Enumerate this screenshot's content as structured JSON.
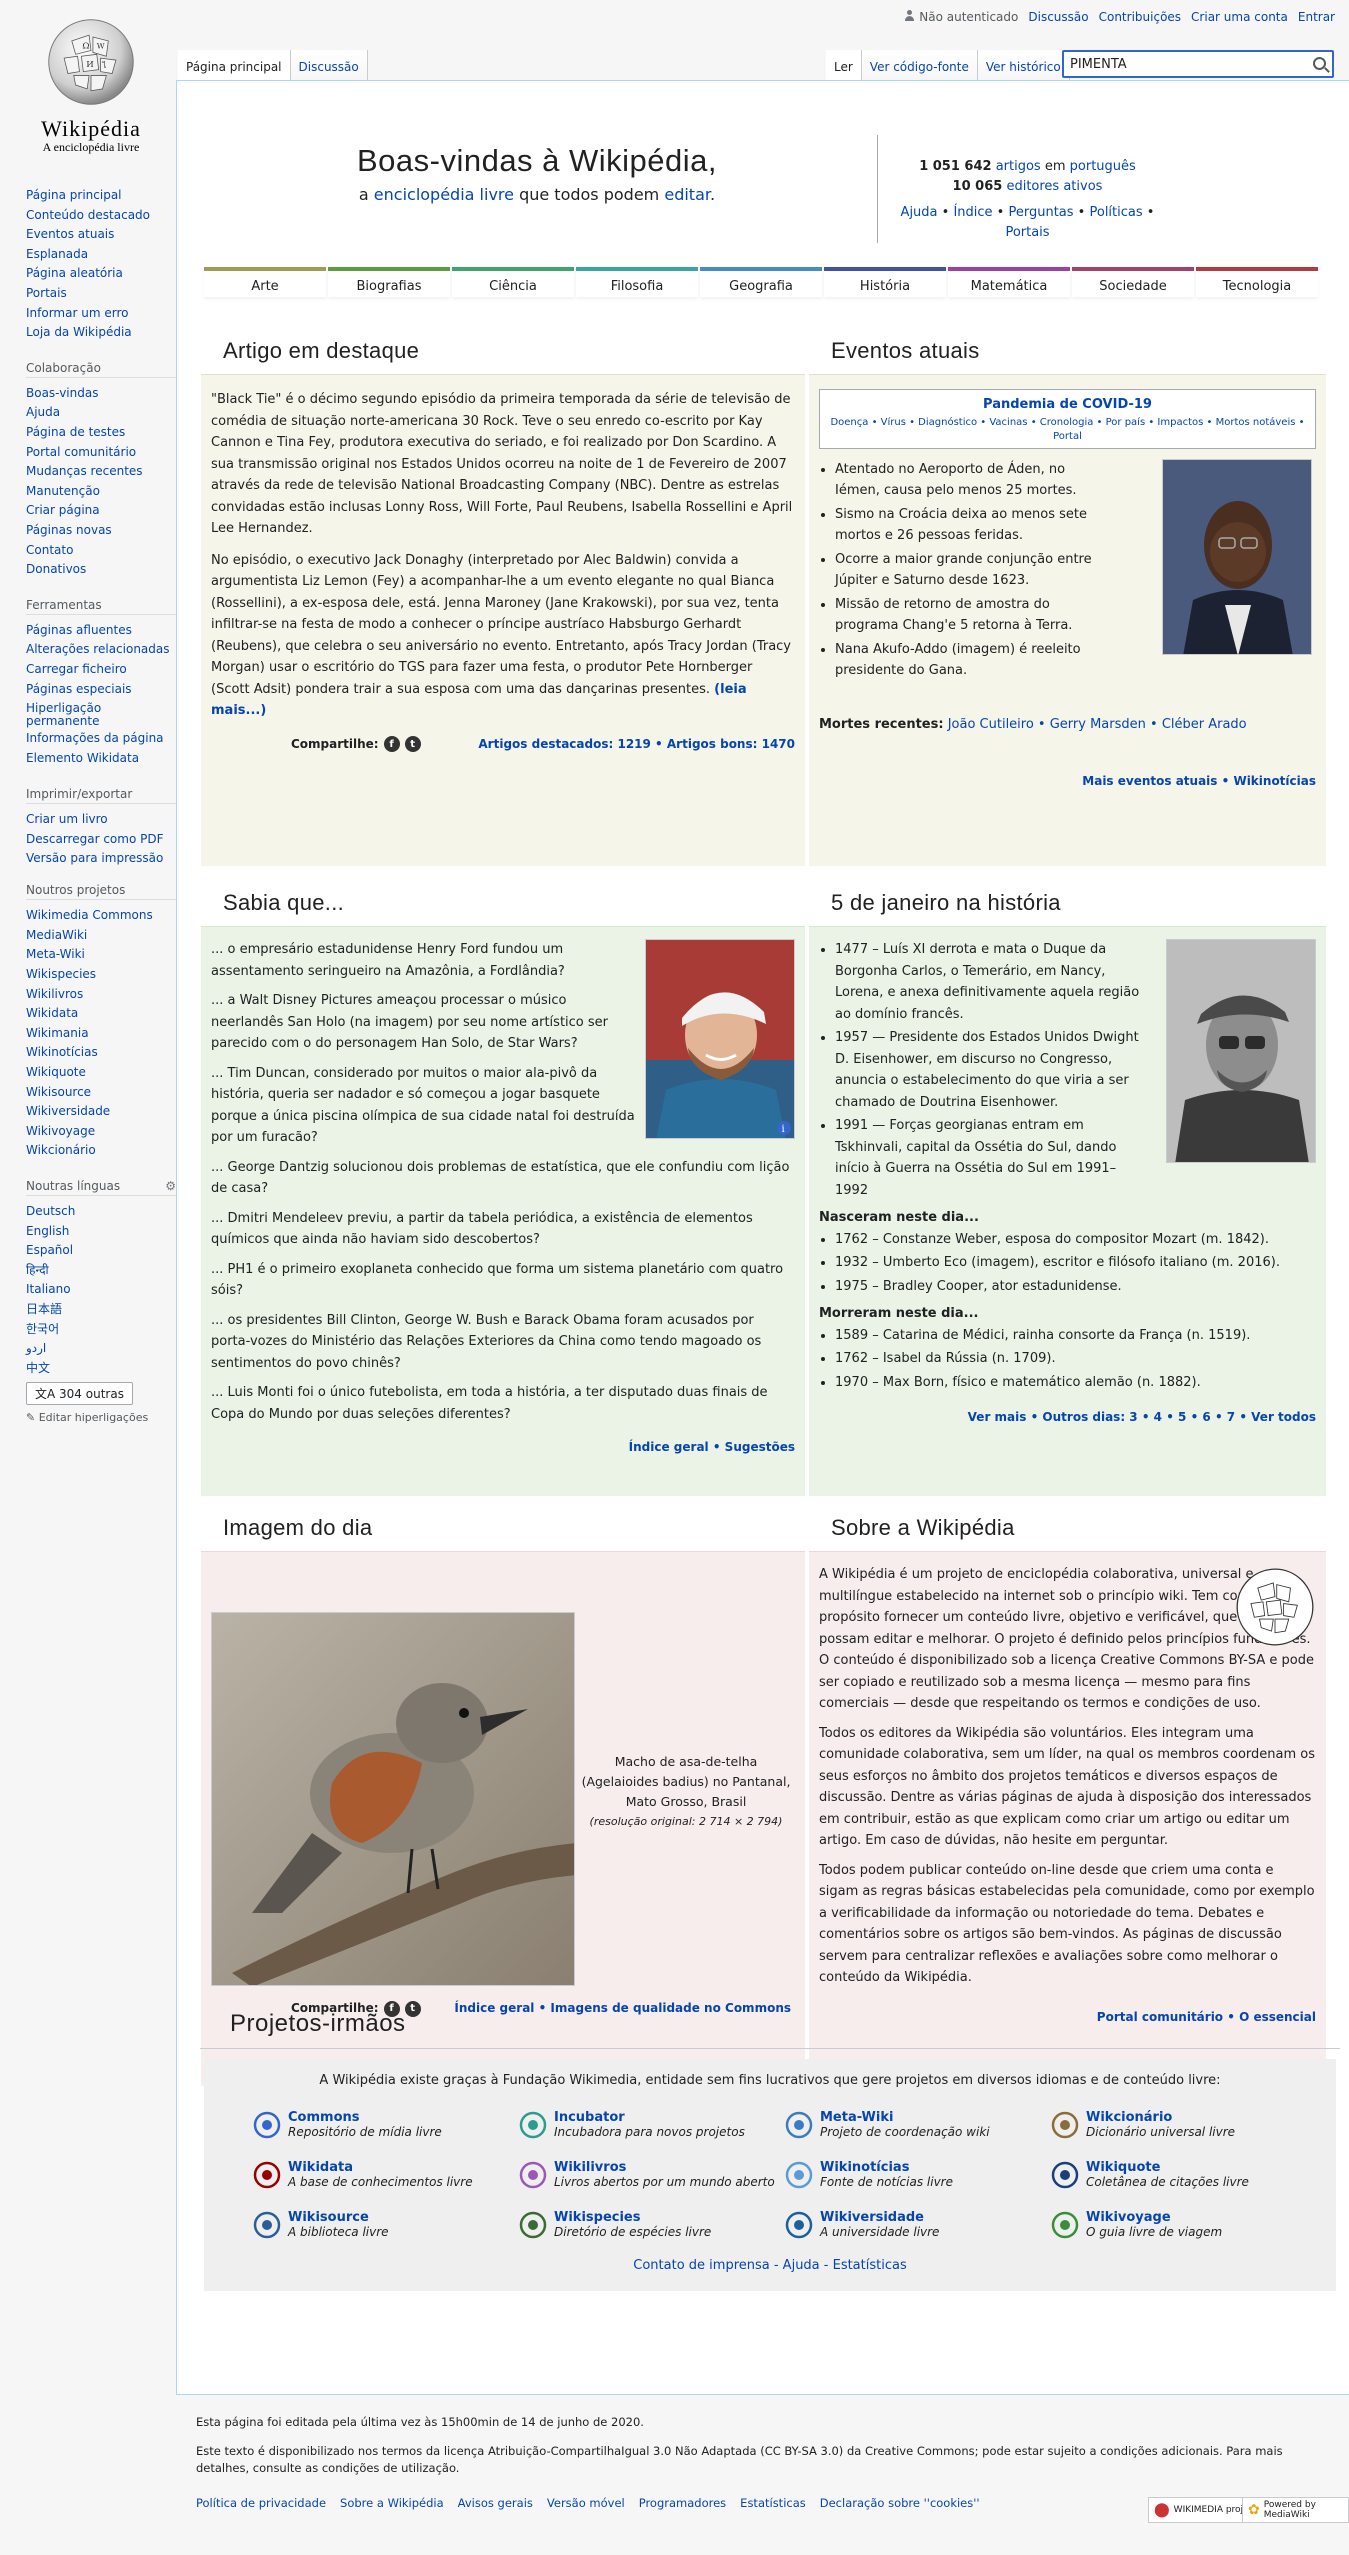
{
  "personal": {
    "not_logged": "Não autenticado",
    "talk": "Discussão",
    "contribs": "Contribuições",
    "create": "Criar uma conta",
    "login": "Entrar"
  },
  "logo": {
    "wordmark": "Wikipédia",
    "tagline": "A enciclopédia livre"
  },
  "tabs": {
    "main_page": "Página principal",
    "discussion": "Discussão",
    "read": "Ler",
    "view_source": "Ver código-fonte",
    "history": "Ver histórico"
  },
  "search": {
    "value": "PIMENTA"
  },
  "sidebar": {
    "nav": [
      "Página principal",
      "Conteúdo destacado",
      "Eventos atuais",
      "Esplanada",
      "Página aleatória",
      "Portais",
      "Informar um erro",
      "Loja da Wikipédia"
    ],
    "collab_title": "Colaboração",
    "collab": [
      "Boas-vindas",
      "Ajuda",
      "Página de testes",
      "Portal comunitário",
      "Mudanças recentes",
      "Manutenção",
      "Criar página",
      "Páginas novas",
      "Contato",
      "Donativos"
    ],
    "tools_title": "Ferramentas",
    "tools": [
      "Páginas afluentes",
      "Alterações relacionadas",
      "Carregar ficheiro",
      "Páginas especiais",
      "Hiperligação permanente",
      "Informações da página",
      "Elemento Wikidata"
    ],
    "print_title": "Imprimir/exportar",
    "print": [
      "Criar um livro",
      "Descarregar como PDF",
      "Versão para impressão"
    ],
    "projects_title": "Noutros projetos",
    "projects": [
      "Wikimedia Commons",
      "MediaWiki",
      "Meta-Wiki",
      "Wikispecies",
      "Wikilivros",
      "Wikidata",
      "Wikimania",
      "Wikinotícias",
      "Wikiquote",
      "Wikisource",
      "Wikiversidade",
      "Wikivoyage",
      "Wikcionário"
    ],
    "langs_title": "Noutras línguas",
    "langs": [
      "Deutsch",
      "English",
      "Español",
      "हिन्दी",
      "Italiano",
      "日本語",
      "한국어",
      "اردو",
      "中文"
    ],
    "more_langs": "304 outras",
    "edit_links": "Editar hiperligações"
  },
  "welcome": {
    "title": "Boas-vindas à Wikipédia,",
    "sub_a": "a ",
    "sub_link1": "enciclopédia livre",
    "sub_b": " que todos podem ",
    "sub_link2": "editar",
    "sub_c": "."
  },
  "stats": {
    "articles_count": "1 051 642",
    "articles_word": "artigos",
    "in": " em ",
    "language": "português",
    "editors_count": "10 065",
    "editors_word": "editores ativos",
    "links": [
      "Ajuda",
      "Índice",
      "Perguntas",
      "Políticas",
      "Portais"
    ]
  },
  "portals": [
    {
      "name": "Arte",
      "color": "#9d9d53"
    },
    {
      "name": "Biografias",
      "color": "#5d9b41"
    },
    {
      "name": "Ciência",
      "color": "#41a46d"
    },
    {
      "name": "Filosofia",
      "color": "#3aa3a3"
    },
    {
      "name": "Geografia",
      "color": "#468bc2"
    },
    {
      "name": "História",
      "color": "#4152a3"
    },
    {
      "name": "Matemática",
      "color": "#9a41a3"
    },
    {
      "name": "Sociedade",
      "color": "#a3416a"
    },
    {
      "name": "Tecnologia",
      "color": "#b03d3d"
    }
  ],
  "featured": {
    "title": "Artigo em destaque",
    "p1": "\"Black Tie\" é o décimo segundo episódio da primeira temporada da série de televisão de comédia de situação norte-americana 30 Rock. Teve o seu enredo co-escrito por Kay Cannon e Tina Fey, produtora executiva do seriado, e foi realizado por Don Scardino. A sua transmissão original nos Estados Unidos ocorreu na noite de 1 de Fevereiro de 2007 através da rede de televisão National Broadcasting Company (NBC). Dentre as estrelas convidadas estão inclusas Lonny Ross, Will Forte, Paul Reubens, Isabella Rossellini e April Lee Hernandez.",
    "p2": "No episódio, o executivo Jack Donaghy (interpretado por Alec Baldwin) convida a argumentista Liz Lemon (Fey) a acompanhar-lhe a um evento elegante no qual Bianca (Rossellini), a ex-esposa dele, está. Jenna Maroney (Jane Krakowski), por sua vez, tenta infiltrar-se na festa de modo a conhecer o príncipe austríaco Habsburgo Gerhardt (Reubens), que celebra o seu aniversário no evento. Entretanto, após Tracy Jordan (Tracy Morgan) usar o escritório do TGS para fazer uma festa, o produtor Pete Hornberger (Scott Adsit) pondera trair a sua esposa com uma das dançarinas presentes.",
    "more": "(leia mais...)",
    "share": "Compartilhe:",
    "footer": "Artigos destacados: 1219 • Artigos bons: 1470"
  },
  "events": {
    "title": "Eventos atuais",
    "covid_title": "Pandemia de COVID-19",
    "covid_links": "Doença • Vírus • Diagnóstico • Vacinas • Cronologia • Por país • Impactos • Mortos notáveis • Portal",
    "items": [
      "Atentado no Aeroporto de Áden, no Iémen, causa pelo menos 25 mortes.",
      "Sismo na Croácia deixa ao menos sete mortos e 26 pessoas feridas.",
      "Ocorre a maior grande conjunção entre Júpiter e Saturno desde 1623.",
      "Missão de retorno de amostra do programa Chang'e 5 retorna à Terra.",
      "Nana Akufo-Addo (imagem) é reeleito presidente do Gana."
    ],
    "deaths_label": "Mortes recentes:",
    "deaths": "João Cutileiro • Gerry Marsden • Cléber Arado",
    "footer": "Mais eventos atuais • Wikinotícias"
  },
  "didyouknow": {
    "title": "Sabia que...",
    "items": [
      "... o empresário estadunidense Henry Ford fundou um assentamento seringueiro na Amazônia, a Fordlândia?",
      "... a Walt Disney Pictures ameaçou processar o músico neerlandês San Holo (na imagem) por seu nome artístico ser parecido com o do personagem Han Solo, de Star Wars?",
      "... Tim Duncan, considerado por muitos o maior ala-pivô da história, queria ser nadador e só começou a jogar basquete porque a única piscina olímpica de sua cidade natal foi destruída por um furacão?",
      "... George Dantzig solucionou dois problemas de estatística, que ele confundiu com lição de casa?",
      "... Dmitri Mendeleev previu, a partir da tabela periódica, a existência de elementos químicos que ainda não haviam sido descobertos?",
      "... PH1 é o primeiro exoplaneta conhecido que forma um sistema planetário com quatro sóis?",
      "... os presidentes Bill Clinton, George W. Bush e Barack Obama foram acusados por porta-vozes do Ministério das Relações Exteriores da China como tendo magoado os sentimentos do povo chinês?",
      "... Luis Monti foi o único futebolista, em toda a história, a ter disputado duas finais de Copa do Mundo por duas seleções diferentes?"
    ],
    "footer": "Índice geral • Sugestões"
  },
  "onthisday": {
    "title": "5 de janeiro na história",
    "items": [
      "1477 – Luís XI derrota e mata o Duque da Borgonha Carlos, o Temerário, em Nancy, Lorena, e anexa definitivamente aquela região ao domínio francês.",
      "1957 — Presidente dos Estados Unidos Dwight D. Eisenhower, em discurso no Congresso, anuncia o estabelecimento do que viria a ser chamado de Doutrina Eisenhower.",
      "1991 — Forças georgianas entram em Tskhinvali, capital da Ossétia do Sul, dando início à Guerra na Ossétia do Sul em 1991–1992"
    ],
    "born_label": "Nasceram neste dia...",
    "born": [
      "1762 – Constanze Weber, esposa do compositor Mozart (m. 1842).",
      "1932 – Umberto Eco (imagem), escritor e filósofo italiano (m. 2016).",
      "1975 – Bradley Cooper, ator estadunidense."
    ],
    "died_label": "Morreram neste dia...",
    "died": [
      "1589 – Catarina de Médici, rainha consorte da França (n. 1519).",
      "1762 – Isabel da Rússia (n. 1709).",
      "1970 – Max Born, físico e matemático alemão (n. 1882)."
    ],
    "footer": "Ver mais • Outros dias: 3 • 4 • 5 • 6 • 7 • Ver todos"
  },
  "pictureofday": {
    "title": "Imagem do dia",
    "caption_1": "Macho de asa-de-telha",
    "caption_2": "(Agelaioides badius) no Pantanal,",
    "caption_3": "Mato Grosso, Brasil",
    "caption_4": "(resolução original: 2 714 × 2 794)",
    "share": "Compartilhe:",
    "footer": "Índice geral • Imagens de qualidade no Commons"
  },
  "about": {
    "title": "Sobre a Wikipédia",
    "p1": "A Wikipédia é um projeto de enciclopédia colaborativa, universal e multilíngue estabelecido na internet sob o princípio wiki. Tem como propósito fornecer um conteúdo livre, objetivo e verificável, que todos possam editar e melhorar. O projeto é definido pelos princípios fundadores. O conteúdo é disponibilizado sob a licença Creative Commons BY-SA e pode ser copiado e reutilizado sob a mesma licença — mesmo para fins comerciais — desde que respeitando os termos e condições de uso.",
    "p2": "Todos os editores da Wikipédia são voluntários. Eles integram uma comunidade colaborativa, sem um líder, na qual os membros coordenam os seus esforços no âmbito dos projetos temáticos e diversos espaços de discussão. Dentre as várias páginas de ajuda à disposição dos interessados em contribuir, estão as que explicam como criar um artigo ou editar um artigo. Em caso de dúvidas, não hesite em perguntar.",
    "p3": "Todos podem publicar conteúdo on-line desde que criem uma conta e sigam as regras básicas estabelecidas pela comunidade, como por exemplo a verificabilidade da informação ou notoriedade do tema. Debates e comentários sobre os artigos são bem-vindos. As páginas de discussão servem para centralizar reflexões e avaliações sobre como melhorar o conteúdo da Wikipédia.",
    "footer": "Portal comunitário • O essencial"
  },
  "sisters": {
    "title": "Projetos-irmãos",
    "intro": "A Wikipédia existe graças à Fundação Wikimedia, entidade sem fins lucrativos que gere projetos em diversos idiomas e de conteúdo livre:",
    "projects": [
      {
        "name": "Commons",
        "desc": "Repositório de mídia livre",
        "icon": "commons-icon",
        "color": "#3366cc"
      },
      {
        "name": "Incubator",
        "desc": "Incubadora para novos projetos",
        "icon": "incubator-icon",
        "color": "#2a9d8f"
      },
      {
        "name": "Meta-Wiki",
        "desc": "Projeto de coordenação wiki",
        "icon": "metawiki-icon",
        "color": "#3b7bbf"
      },
      {
        "name": "Wikcionário",
        "desc": "Dicionário universal livre",
        "icon": "wiktionary-icon",
        "color": "#8a6d3b"
      },
      {
        "name": "Wikidata",
        "desc": "A base de conhecimentos livre",
        "icon": "wikidata-icon",
        "color": "#990000"
      },
      {
        "name": "Wikilivros",
        "desc": "Livros abertos por um mundo aberto",
        "icon": "wikibooks-icon",
        "color": "#9b59b6"
      },
      {
        "name": "Wikinotícias",
        "desc": "Fonte de notícias livre",
        "icon": "wikinews-icon",
        "color": "#5b9bd5"
      },
      {
        "name": "Wikiquote",
        "desc": "Coletânea de citações livre",
        "icon": "wikiquote-icon",
        "color": "#1a3f7a"
      },
      {
        "name": "Wikisource",
        "desc": "A biblioteca livre",
        "icon": "wikisource-icon",
        "color": "#2c5d99"
      },
      {
        "name": "Wikispecies",
        "desc": "Diretório de espécies livre",
        "icon": "wikispecies-icon",
        "color": "#3a6b35"
      },
      {
        "name": "Wikiversidade",
        "desc": "A universidade livre",
        "icon": "wikiversity-icon",
        "color": "#1f5f99"
      },
      {
        "name": "Wikivoyage",
        "desc": "O guia livre de viagem",
        "icon": "wikivoyage-icon",
        "color": "#3a8e3a"
      }
    ],
    "contact": "Contato de imprensa - Ajuda - Estatísticas"
  },
  "footer": {
    "edited": "Esta página foi editada pela última vez às 15h00min de 14 de junho de 2020.",
    "license": "Este texto é disponibilizado nos termos da licença Atribuição-CompartilhaIgual 3.0 Não Adaptada (CC BY-SA 3.0) da Creative Commons; pode estar sujeito a condições adicionais. Para mais detalhes, consulte as condições de utilização.",
    "links": [
      "Política de privacidade",
      "Sobre a Wikipédia",
      "Avisos gerais",
      "Versão móvel",
      "Programadores",
      "Estatísticas",
      "Declaração sobre ''cookies''"
    ],
    "badge_wm": "WIKIMEDIA project",
    "badge_mw": "Powered by MediaWiki"
  }
}
